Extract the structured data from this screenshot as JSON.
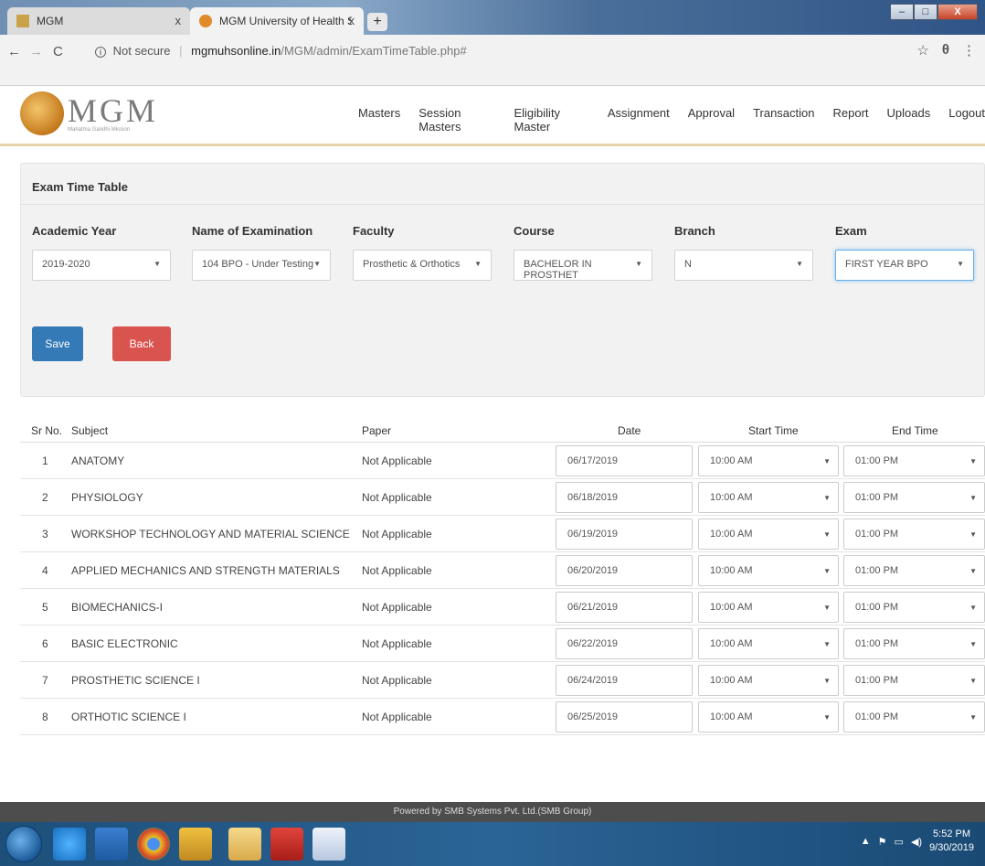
{
  "browser": {
    "tabs": [
      {
        "title": "MGM"
      },
      {
        "title": "MGM University of Health Scienc"
      }
    ],
    "url_status": "Not secure",
    "url_domain": "mgmuhsonline.in",
    "url_path": "/MGM/admin/ExamTimeTable.php#"
  },
  "app": {
    "logo_title": "MGM",
    "logo_subtitle": "Mahatma Gandhi Mission",
    "menu": [
      "Masters",
      "Session Masters",
      "Eligibility Master",
      "Assignment",
      "Approval",
      "Transaction",
      "Report",
      "Uploads",
      "Logout"
    ]
  },
  "form": {
    "title": "Exam Time Table",
    "fields": [
      {
        "label": "Academic Year",
        "value": "2019-2020"
      },
      {
        "label": "Name of Examination",
        "value": "104 BPO - Under Testing"
      },
      {
        "label": "Faculty",
        "value": "Prosthetic & Orthotics"
      },
      {
        "label": "Course",
        "value": "BACHELOR IN PROSTHET"
      },
      {
        "label": "Branch",
        "value": "N"
      },
      {
        "label": "Exam",
        "value": "FIRST YEAR BPO"
      }
    ],
    "save_label": "Save",
    "back_label": "Back"
  },
  "table": {
    "headers": {
      "sr": "Sr No.",
      "subject": "Subject",
      "paper": "Paper",
      "date": "Date",
      "start": "Start Time",
      "end": "End Time"
    },
    "rows": [
      {
        "sr": "1",
        "subject": "ANATOMY",
        "paper": "Not Applicable",
        "date": "06/17/2019",
        "start": "10:00 AM",
        "end": "01:00 PM"
      },
      {
        "sr": "2",
        "subject": "PHYSIOLOGY",
        "paper": "Not Applicable",
        "date": "06/18/2019",
        "start": "10:00 AM",
        "end": "01:00 PM"
      },
      {
        "sr": "3",
        "subject": "WORKSHOP TECHNOLOGY AND MATERIAL SCIENCE",
        "paper": "Not Applicable",
        "date": "06/19/2019",
        "start": "10:00 AM",
        "end": "01:00 PM"
      },
      {
        "sr": "4",
        "subject": "APPLIED MECHANICS AND STRENGTH MATERIALS",
        "paper": "Not Applicable",
        "date": "06/20/2019",
        "start": "10:00 AM",
        "end": "01:00 PM"
      },
      {
        "sr": "5",
        "subject": "BIOMECHANICS-I",
        "paper": "Not Applicable",
        "date": "06/21/2019",
        "start": "10:00 AM",
        "end": "01:00 PM"
      },
      {
        "sr": "6",
        "subject": "BASIC ELECTRONIC",
        "paper": "Not Applicable",
        "date": "06/22/2019",
        "start": "10:00 AM",
        "end": "01:00 PM"
      },
      {
        "sr": "7",
        "subject": "PROSTHETIC SCIENCE I",
        "paper": "Not Applicable",
        "date": "06/24/2019",
        "start": "10:00 AM",
        "end": "01:00 PM"
      },
      {
        "sr": "8",
        "subject": "ORTHOTIC SCIENCE I",
        "paper": "Not Applicable",
        "date": "06/25/2019",
        "start": "10:00 AM",
        "end": "01:00 PM"
      }
    ]
  },
  "footer": {
    "text": "Powered by SMB Systems Pvt. Ltd.(SMB Group)"
  },
  "taskbar": {
    "time": "5:52 PM",
    "date": "9/30/2019"
  },
  "colors": {
    "save": "#337ab7",
    "back": "#d9534f",
    "footer": "#4d4d4d"
  },
  "icons": [
    "back-arrow-icon",
    "forward-arrow-icon",
    "reload-icon",
    "info-icon",
    "star-icon",
    "account-icon",
    "menu-dots-icon",
    "chevron-down-icon"
  ]
}
